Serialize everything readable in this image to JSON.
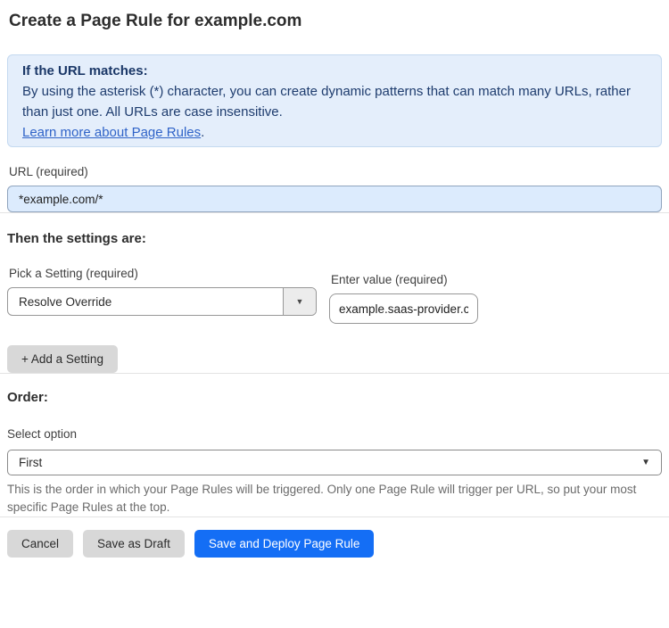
{
  "page": {
    "title": "Create a Page Rule for example.com"
  },
  "info_box": {
    "heading": "If the URL matches:",
    "body": "By using the asterisk (*) character, you can create dynamic patterns that can match many URLs, rather than just one. All URLs are case insensitive.",
    "link_label": "Learn more about Page Rules",
    "link_suffix": "."
  },
  "url_field": {
    "label": "URL (required)",
    "value": "*example.com/*"
  },
  "settings_section": {
    "heading": "Then the settings are:",
    "setting_select": {
      "label": "Pick a Setting (required)",
      "selected": "Resolve Override"
    },
    "value_field": {
      "label": "Enter value (required)",
      "value": "example.saas-provider.c"
    },
    "add_setting_button": "+ Add a Setting"
  },
  "order_section": {
    "heading": "Order:",
    "select_label": "Select option",
    "selected": "First",
    "help_text": "This is the order in which your Page Rules will be triggered. Only one Page Rule will trigger per URL, so put your most specific Page Rules at the top."
  },
  "footer": {
    "cancel_label": "Cancel",
    "save_draft_label": "Save as Draft",
    "save_deploy_label": "Save and Deploy Page Rule"
  },
  "icons": {
    "dropdown_caret": "▼"
  },
  "colors": {
    "primary_blue": "#146ef5",
    "info_box_bg": "#e4eefb",
    "info_box_border": "#c4d9f0",
    "info_text": "#1e3c6e",
    "link_blue": "#2f63c8",
    "url_input_bg": "#dcebfd",
    "gray_button_bg": "#d8d8d8",
    "divider": "#e3e3e3"
  }
}
